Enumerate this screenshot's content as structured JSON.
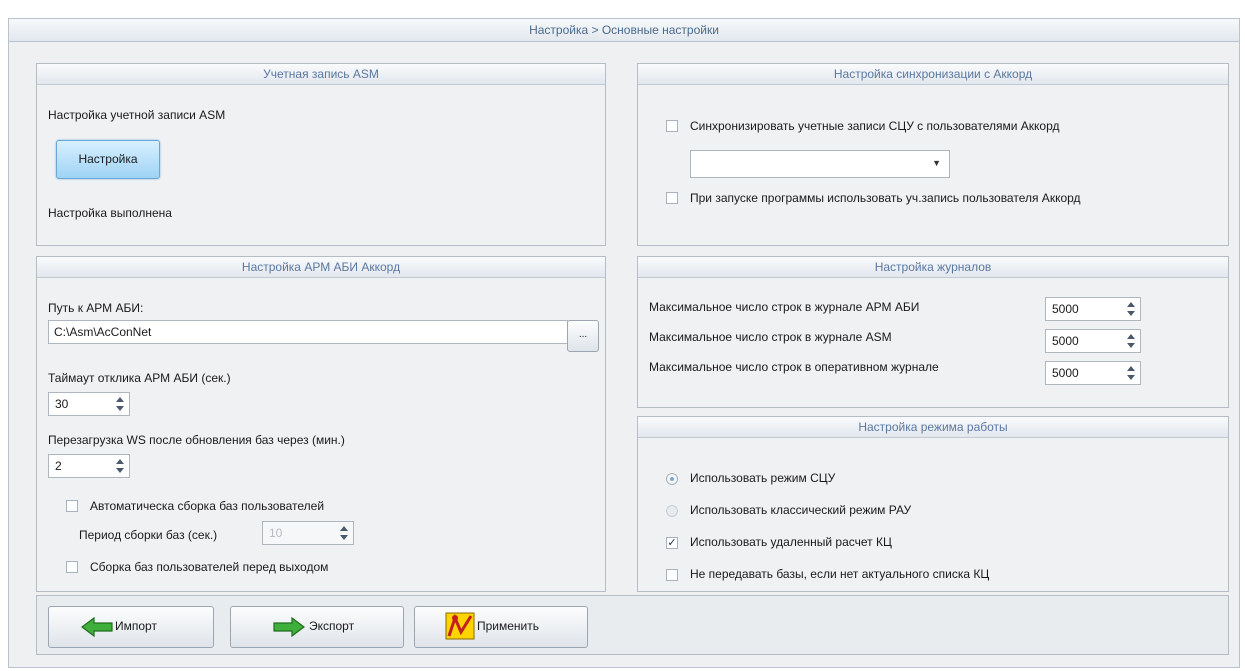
{
  "window": {
    "title": "Настройка > Основные настройки"
  },
  "asm_account": {
    "header": "Учетная запись ASM",
    "label": "Настройка учетной записи ASM",
    "button": "Настройка",
    "status": "Настройка выполнена"
  },
  "akkord_sync": {
    "header": "Настройка синхронизации с Аккорд",
    "sync_checkbox": {
      "label": "Синхронизировать учетные записи СЦУ с пользователями Аккорд",
      "checked": false
    },
    "dropdown_value": "",
    "startup_checkbox": {
      "label": "При запуске программы использовать уч.запись пользователя Аккорд",
      "checked": false
    }
  },
  "arm_abi": {
    "header": "Настройка АРМ АБИ Аккорд",
    "path_label": "Путь к АРМ АБИ:",
    "path_value": "C:\\Asm\\AcConNet",
    "browse_label": "...",
    "timeout_label": "Таймаут отклика АРМ АБИ (сек.)",
    "timeout_value": "30",
    "reload_label": "Перезагрузка WS после обновления баз через (мин.)",
    "reload_value": "2",
    "auto_build": {
      "label": "Автоматическа сборка баз пользователей",
      "checked": false
    },
    "period_label": "Период сборки баз (сек.)",
    "period_value": "10",
    "build_on_exit": {
      "label": "Сборка баз пользователей перед выходом",
      "checked": false
    }
  },
  "logs": {
    "header": "Настройка журналов",
    "rows": [
      {
        "label": "Максимальное число строк в журнале АРМ АБИ",
        "value": "5000"
      },
      {
        "label": "Максимальное число строк в журнале ASM",
        "value": "5000"
      },
      {
        "label": "Максимальное число строк в оперативном журнале",
        "value": "5000"
      }
    ]
  },
  "mode": {
    "header": "Настройка режима работы",
    "radio_scu": {
      "label": "Использовать режим СЦУ",
      "selected": true
    },
    "radio_rau": {
      "label": "Использовать классический режим РАУ",
      "selected": false
    },
    "remote_kc": {
      "label": "Использовать удаленный расчет КЦ",
      "checked": true
    },
    "no_send": {
      "label": "Не передавать базы, если нет актуального списка КЦ",
      "checked": false
    }
  },
  "toolbar": {
    "import_label": "Импорт",
    "export_label": "Экспорт",
    "apply_label": "Применить"
  },
  "colors": {
    "accent_text": "#5a78a0",
    "arrow_green": "#3fae3a",
    "button_blue": "#9fd3f5"
  }
}
